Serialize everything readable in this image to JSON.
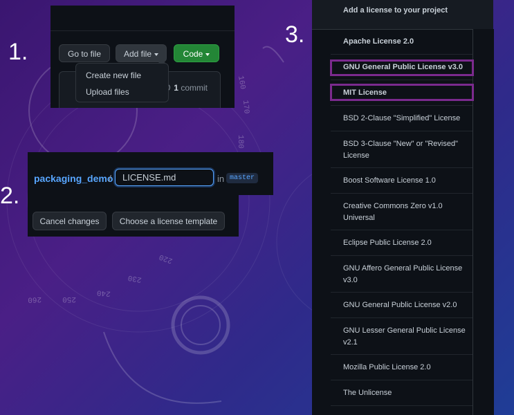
{
  "step_labels": [
    "1.",
    "2.",
    "3."
  ],
  "panel1": {
    "go_to_file": "Go to file",
    "add_file": "Add file",
    "code": "Code",
    "menu": [
      "Create new file",
      "Upload files"
    ],
    "commit_count": "1",
    "commit_label": "commit"
  },
  "panel2": {
    "repo_name": "packaging_demo",
    "separator": "/",
    "filename": "LICENSE.md",
    "in_text": "in",
    "branch": "master",
    "cancel": "Cancel changes",
    "choose_template": "Choose a license template"
  },
  "panel3": {
    "title": "Add a license to your project",
    "licenses": [
      "Apache License 2.0",
      "GNU General Public License v3.0",
      "MIT License",
      "BSD 2-Clause \"Simplified\" License",
      "BSD 3-Clause \"New\" or \"Revised\" License",
      "Boost Software License 1.0",
      "Creative Commons Zero v1.0 Universal",
      "Eclipse Public License 2.0",
      "GNU Affero General Public License v3.0",
      "GNU General Public License v2.0",
      "GNU Lesser General Public License v2.1",
      "Mozilla Public License 2.0",
      "The Unlicense"
    ],
    "highlighted": [
      "GNU General Public License v3.0",
      "MIT License"
    ]
  },
  "background_dial_labels": [
    "160",
    "170",
    "180",
    "220",
    "230",
    "240",
    "250",
    "260"
  ],
  "colors": {
    "highlight": "#7b2a8e",
    "link": "#58a6ff",
    "code_button": "#238636"
  }
}
